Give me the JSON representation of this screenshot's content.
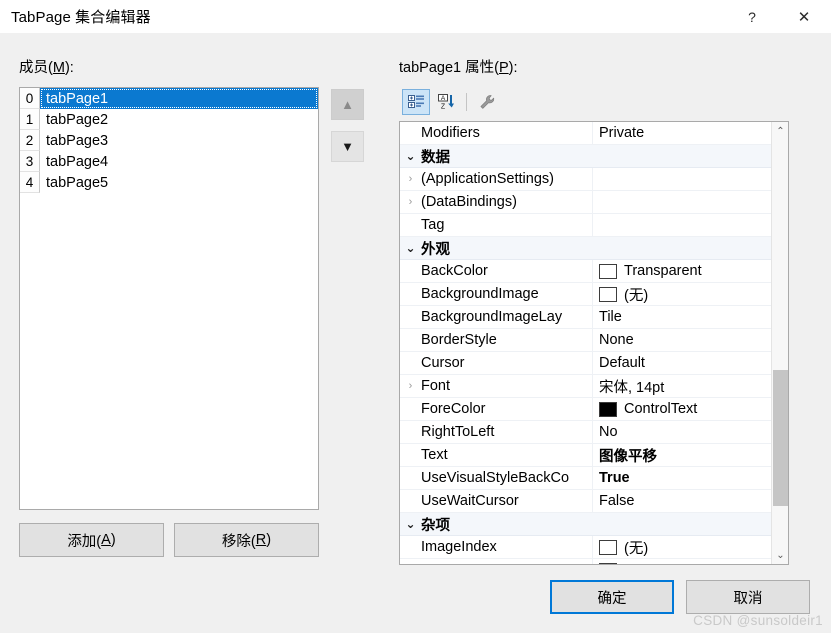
{
  "window": {
    "title": "TabPage 集合编辑器",
    "help_label": "?",
    "close_label": "✕"
  },
  "members_panel": {
    "label_prefix": "成员(",
    "label_accel": "M",
    "label_suffix": "):",
    "items": [
      {
        "index": "0",
        "name": "tabPage1",
        "selected": true
      },
      {
        "index": "1",
        "name": "tabPage2",
        "selected": false
      },
      {
        "index": "2",
        "name": "tabPage3",
        "selected": false
      },
      {
        "index": "3",
        "name": "tabPage4",
        "selected": false
      },
      {
        "index": "4",
        "name": "tabPage5",
        "selected": false
      }
    ],
    "move_up_glyph": "▲",
    "move_down_glyph": "▼",
    "add_prefix": "添加(",
    "add_accel": "A",
    "add_suffix": ")",
    "remove_prefix": "移除(",
    "remove_accel": "R",
    "remove_suffix": ")"
  },
  "properties_panel": {
    "label_prefix": "tabPage1 属性(",
    "label_accel": "P",
    "label_suffix": "):",
    "toolbar": {
      "categorized_title": "categorized-view",
      "alphabetical_title": "alphabetical-sort",
      "wrench_title": "property-pages"
    },
    "rows": [
      {
        "kind": "property",
        "expander": "",
        "name": "Modifiers",
        "value": "Private",
        "swatch": null,
        "modified": false
      },
      {
        "kind": "category",
        "expander": "⌄",
        "name": "数据",
        "value": "",
        "swatch": null,
        "modified": false
      },
      {
        "kind": "property",
        "expander": "›",
        "name": "(ApplicationSettings)",
        "value": "",
        "swatch": null,
        "modified": false
      },
      {
        "kind": "property",
        "expander": "›",
        "name": "(DataBindings)",
        "value": "",
        "swatch": null,
        "modified": false
      },
      {
        "kind": "property",
        "expander": "",
        "name": "Tag",
        "value": "",
        "swatch": null,
        "modified": false
      },
      {
        "kind": "category",
        "expander": "⌄",
        "name": "外观",
        "value": "",
        "swatch": null,
        "modified": false
      },
      {
        "kind": "property",
        "expander": "",
        "name": "BackColor",
        "value": "Transparent",
        "swatch": "#ffffff",
        "modified": false
      },
      {
        "kind": "property",
        "expander": "",
        "name": "BackgroundImage",
        "value": "(无)",
        "swatch": "#ffffff",
        "modified": false
      },
      {
        "kind": "property",
        "expander": "",
        "name": "BackgroundImageLay",
        "value": "Tile",
        "swatch": null,
        "modified": false
      },
      {
        "kind": "property",
        "expander": "",
        "name": "BorderStyle",
        "value": "None",
        "swatch": null,
        "modified": false
      },
      {
        "kind": "property",
        "expander": "",
        "name": "Cursor",
        "value": "Default",
        "swatch": null,
        "modified": false
      },
      {
        "kind": "property",
        "expander": "›",
        "name": "Font",
        "value": "宋体, 14pt",
        "swatch": null,
        "modified": false
      },
      {
        "kind": "property",
        "expander": "",
        "name": "ForeColor",
        "value": "ControlText",
        "swatch": "#000000",
        "modified": false
      },
      {
        "kind": "property",
        "expander": "",
        "name": "RightToLeft",
        "value": "No",
        "swatch": null,
        "modified": false
      },
      {
        "kind": "property",
        "expander": "",
        "name": "Text",
        "value": "图像平移",
        "swatch": null,
        "modified": true
      },
      {
        "kind": "property",
        "expander": "",
        "name": "UseVisualStyleBackCo",
        "value": "True",
        "swatch": null,
        "modified": true
      },
      {
        "kind": "property",
        "expander": "",
        "name": "UseWaitCursor",
        "value": "False",
        "swatch": null,
        "modified": false
      },
      {
        "kind": "category",
        "expander": "⌄",
        "name": "杂项",
        "value": "",
        "swatch": null,
        "modified": false
      },
      {
        "kind": "property",
        "expander": "",
        "name": "ImageIndex",
        "value": "(无)",
        "swatch": "#ffffff",
        "modified": false
      },
      {
        "kind": "property",
        "expander": "",
        "name": "",
        "value": "",
        "swatch": "#ffffff",
        "modified": false
      }
    ],
    "scrollbar": {
      "up_glyph": "⌃",
      "down_glyph": "⌄"
    }
  },
  "dialog_buttons": {
    "ok_label": "确定",
    "cancel_label": "取消"
  },
  "watermark": "CSDN @sunsoldeir1",
  "colors": {
    "selection_blue": "#0b79d0",
    "focus_blue": "#0078d7",
    "dialog_bg": "#f0f0f0",
    "category_bg": "#f4f7fb"
  }
}
